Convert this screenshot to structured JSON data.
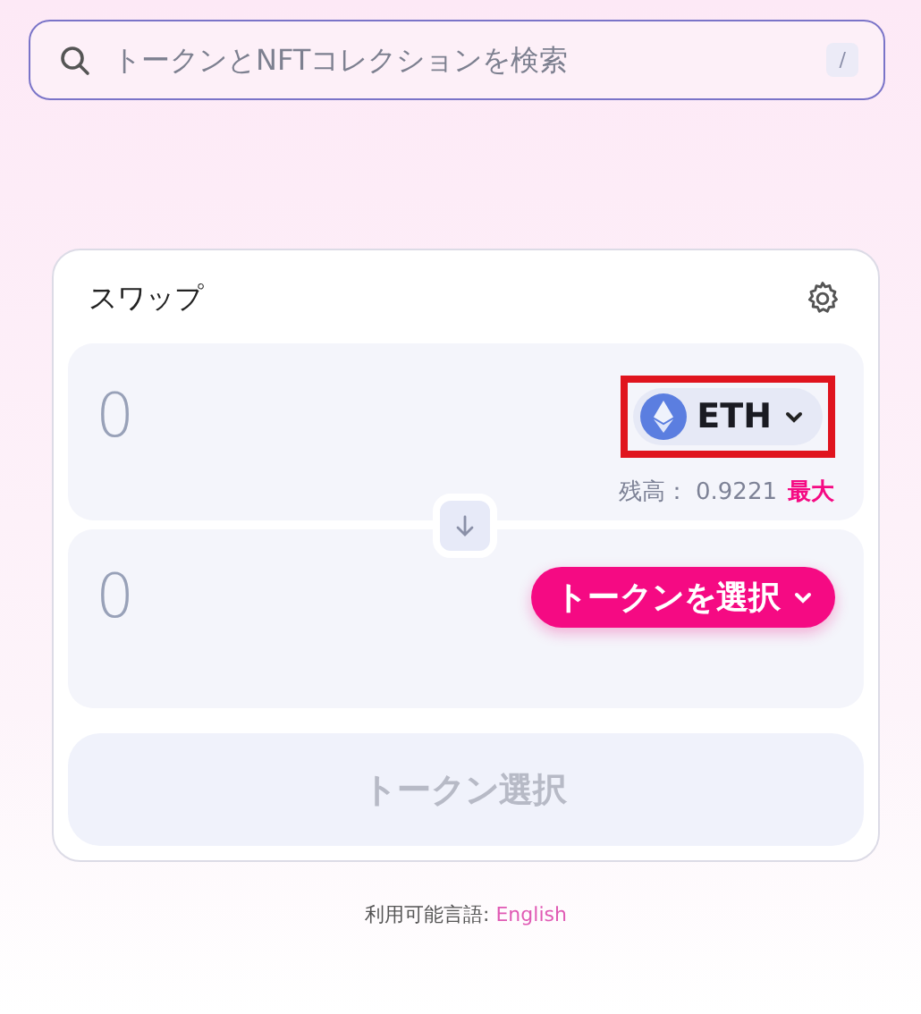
{
  "search": {
    "placeholder": "トークンとNFTコレクションを検索",
    "shortcut": "/"
  },
  "swap": {
    "title": "スワップ",
    "panels": [
      {
        "amount": "0",
        "token": {
          "kind": "token",
          "label": "ETH",
          "highlighted": true
        },
        "balance_label": "残高：",
        "balance": "0.9221",
        "max": "最大"
      },
      {
        "amount": "0",
        "token": {
          "kind": "select",
          "label": "トークンを選択",
          "highlighted": false
        }
      }
    ],
    "submit": {
      "label": "トークン選択",
      "disabled": true
    }
  },
  "footer": {
    "text": "利用可能言語:",
    "link": "English"
  }
}
